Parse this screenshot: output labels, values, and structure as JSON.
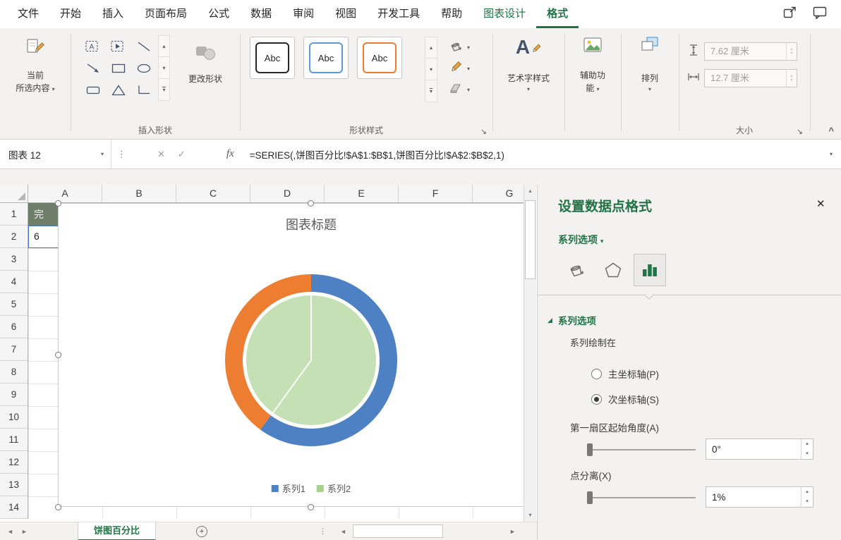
{
  "icons": {
    "dropdown": "▾",
    "scroll_up": "▴",
    "scroll_down": "▾",
    "cancel": "✕",
    "enter": "✓",
    "fx": "fx",
    "close": "✕",
    "collapse_ribbon": "^",
    "drag_dots": "⋮",
    "nav_left": "◄",
    "nav_right": "►",
    "vscroll_up": "▴",
    "vscroll_down": "▾",
    "add_sheet": "+",
    "section_marker": "◢",
    "spin_up": "▴",
    "spin_down": "▾",
    "dialog_launcher": "↘",
    "ellipsis": "⋮",
    "wordart_letter": "A"
  },
  "ribbon": {
    "tabs": [
      {
        "label": "文件"
      },
      {
        "label": "开始"
      },
      {
        "label": "插入"
      },
      {
        "label": "页面布局"
      },
      {
        "label": "公式"
      },
      {
        "label": "数据"
      },
      {
        "label": "审阅"
      },
      {
        "label": "视图"
      },
      {
        "label": "开发工具"
      },
      {
        "label": "帮助"
      },
      {
        "label": "图表设计",
        "contextual": true
      },
      {
        "label": "格式",
        "contextual": true,
        "active": true
      }
    ],
    "current_selection": {
      "line1": "当前",
      "line2": "所选内容"
    },
    "insert_shapes": {
      "label": "插入形状",
      "change_shape": "更改形状"
    },
    "shape_styles": {
      "label": "形状样式",
      "swatches": [
        {
          "label": "Abc",
          "color": "#262626"
        },
        {
          "label": "Abc",
          "color": "#5b9bd5"
        },
        {
          "label": "Abc",
          "color": "#ed7d31"
        }
      ]
    },
    "wordart": {
      "label": "艺术字样式"
    },
    "accessibility": {
      "line1": "辅助功",
      "line2": "能"
    },
    "arrange": {
      "label": "排列"
    },
    "size": {
      "label": "大小",
      "height": "7.62 厘米",
      "width": "12.7 厘米"
    }
  },
  "formula_bar": {
    "name_box": "图表 12",
    "formula": "=SERIES(,饼图百分比!$A$1:$B$1,饼图百分比!$A$2:$B$2,1)"
  },
  "grid": {
    "columns": [
      "A",
      "B",
      "C",
      "D",
      "E",
      "F",
      "G"
    ],
    "rows": [
      "1",
      "2",
      "3",
      "4",
      "5",
      "6",
      "7",
      "8",
      "9",
      "10",
      "11",
      "12",
      "13",
      "14"
    ],
    "cells": {
      "a1": "完",
      "a2": "6"
    }
  },
  "chart": {
    "title": "图表标题",
    "legend": [
      {
        "label": "系列1",
        "color": "#4e81c4"
      },
      {
        "label": "系列2",
        "color": "#a9d08e"
      }
    ]
  },
  "chart_data": {
    "type": "pie",
    "title": "图表标题",
    "legend": [
      "系列1",
      "系列2"
    ],
    "legend_position": "bottom",
    "series": [
      {
        "name": "系列1",
        "role": "outer-doughnut",
        "values": [
          60,
          40
        ],
        "colors": [
          "#4e81c4",
          "#ed7d31"
        ]
      },
      {
        "name": "系列2",
        "role": "inner-pie",
        "values": [
          60,
          40
        ],
        "colors": [
          "#c5e0b4",
          "#c5e0b4"
        ]
      }
    ]
  },
  "sheet_tabs": {
    "active": "饼图百分比"
  },
  "pane": {
    "title": "设置数据点格式",
    "series_options_dropdown": "系列选项",
    "section_title": "系列选项",
    "plot_series_on": "系列绘制在",
    "primary_axis": "主坐标轴(P)",
    "secondary_axis": "次坐标轴(S)",
    "angle_label": "第一扇区起始角度(A)",
    "angle_value": "0°",
    "explosion_label": "点分离(X)",
    "explosion_value": "1%"
  }
}
